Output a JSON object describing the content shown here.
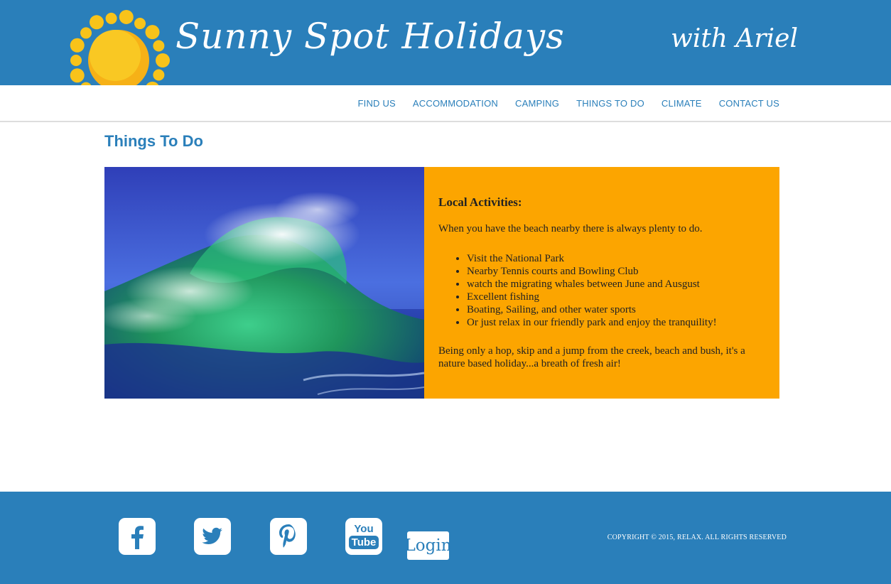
{
  "header": {
    "site_title": "Sunny Spot Holidays",
    "tagline": "with Ariel",
    "logo_icon": "sun-icon"
  },
  "nav": {
    "items": [
      "FIND US",
      "ACCOMMODATION",
      "CAMPING",
      "THINGS TO DO",
      "CLIMATE",
      "CONTACT US"
    ]
  },
  "page": {
    "title": "Things To Do"
  },
  "panel": {
    "heading": "Local Activities:",
    "intro": "When you have the beach nearby there is always plenty to do.",
    "activities": [
      "Visit the National Park",
      "Nearby Tennis courts and Bowling Club",
      "watch the migrating whales between June and Ausgust",
      "Excellent fishing",
      "Boating, Sailing, and other water sports",
      "Or just relax in our friendly park and enjoy the tranquility!"
    ],
    "outro": "Being only a hop, skip and a jump from the creek, beach and bush, it's a nature based holiday...a breath of fresh air!"
  },
  "footer": {
    "social_icons": [
      "facebook-icon",
      "twitter-icon",
      "pinterest-icon",
      "youtube-icon"
    ],
    "youtube_you": "You",
    "youtube_tube": "Tube",
    "login_label": "Login",
    "copyright": "COPYRIGHT © 2015, RELAX. ALL RIGHTS RESERVED"
  },
  "colors": {
    "brand_blue": "#2a7fba",
    "panel_orange": "#fca500",
    "sun_yellow": "#f8c31a"
  }
}
